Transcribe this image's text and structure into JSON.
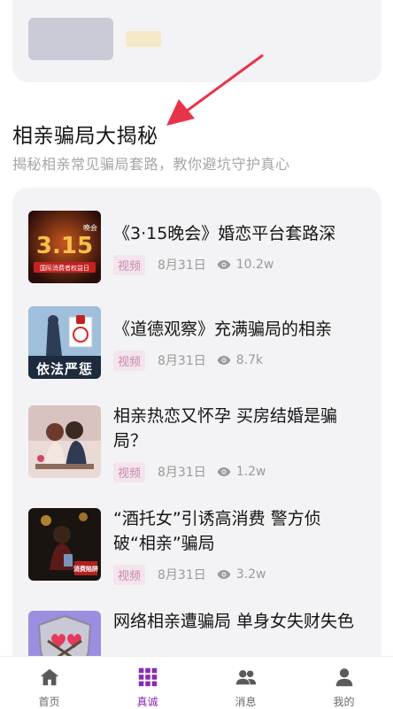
{
  "section": {
    "title": "相亲骗局大揭秘",
    "subtitle": "揭秘相亲常见骗局套路，教你避坑守护真心"
  },
  "articles": [
    {
      "title": "《3·15晚会》婚恋平台套路深",
      "tag": "视频",
      "date": "8月31日",
      "views": "10.2w",
      "thumb_icon": "315-gala-thumbnail"
    },
    {
      "title": "《道德观察》充满骗局的相亲",
      "tag": "视频",
      "date": "8月31日",
      "views": "8.7k",
      "thumb_icon": "law-enforcement-thumbnail",
      "thumb_text": "依法严惩"
    },
    {
      "title": "相亲热恋又怀孕 买房结婚是骗局？",
      "tag": "视频",
      "date": "8月31日",
      "views": "1.2w",
      "thumb_icon": "couple-thumbnail"
    },
    {
      "title": "“酒托女”引诱高消费 警方侦破“相亲”骗局",
      "tag": "视频",
      "date": "8月31日",
      "views": "3.2w",
      "thumb_icon": "bar-trap-thumbnail"
    },
    {
      "title": "网络相亲遭骗局 单身女失财失色",
      "tag": "",
      "date": "",
      "views": "",
      "thumb_icon": "heart-shield-thumbnail"
    }
  ],
  "tabbar": [
    {
      "label": "首页",
      "icon": "home-icon",
      "active": false
    },
    {
      "label": "真诚",
      "icon": "grid-icon",
      "active": true
    },
    {
      "label": "消息",
      "icon": "people-icon",
      "active": false
    },
    {
      "label": "我的",
      "icon": "person-icon",
      "active": false
    }
  ],
  "colors": {
    "accent": "#8a2bb3",
    "tag_bg": "#f4e4ec",
    "tag_text": "#c58ab0",
    "arrow": "#e8344a"
  }
}
